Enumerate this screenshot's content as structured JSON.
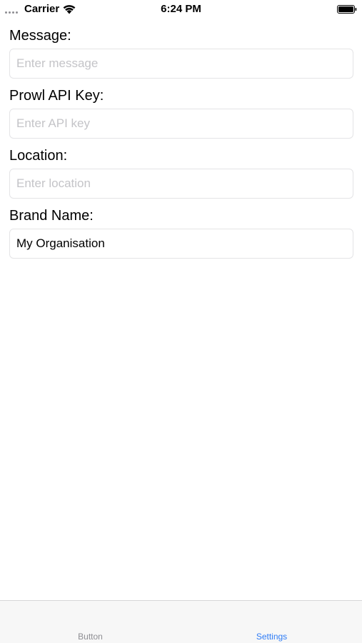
{
  "status_bar": {
    "carrier": "Carrier",
    "time": "6:24 PM",
    "signal_icon": "signal-dots-icon",
    "wifi_icon": "wifi-icon",
    "battery_icon": "battery-icon"
  },
  "form": {
    "fields": [
      {
        "label": "Message:",
        "value": "",
        "placeholder": "Enter message"
      },
      {
        "label": "Prowl API Key:",
        "value": "",
        "placeholder": "Enter API key"
      },
      {
        "label": "Location:",
        "value": "",
        "placeholder": "Enter location"
      },
      {
        "label": "Brand Name:",
        "value": "My Organisation",
        "placeholder": ""
      }
    ]
  },
  "tab_bar": {
    "tabs": [
      {
        "label": "Button",
        "active": false
      },
      {
        "label": "Settings",
        "active": true
      }
    ],
    "active_color": "#2f7cf6",
    "inactive_color": "#8e8e93"
  }
}
